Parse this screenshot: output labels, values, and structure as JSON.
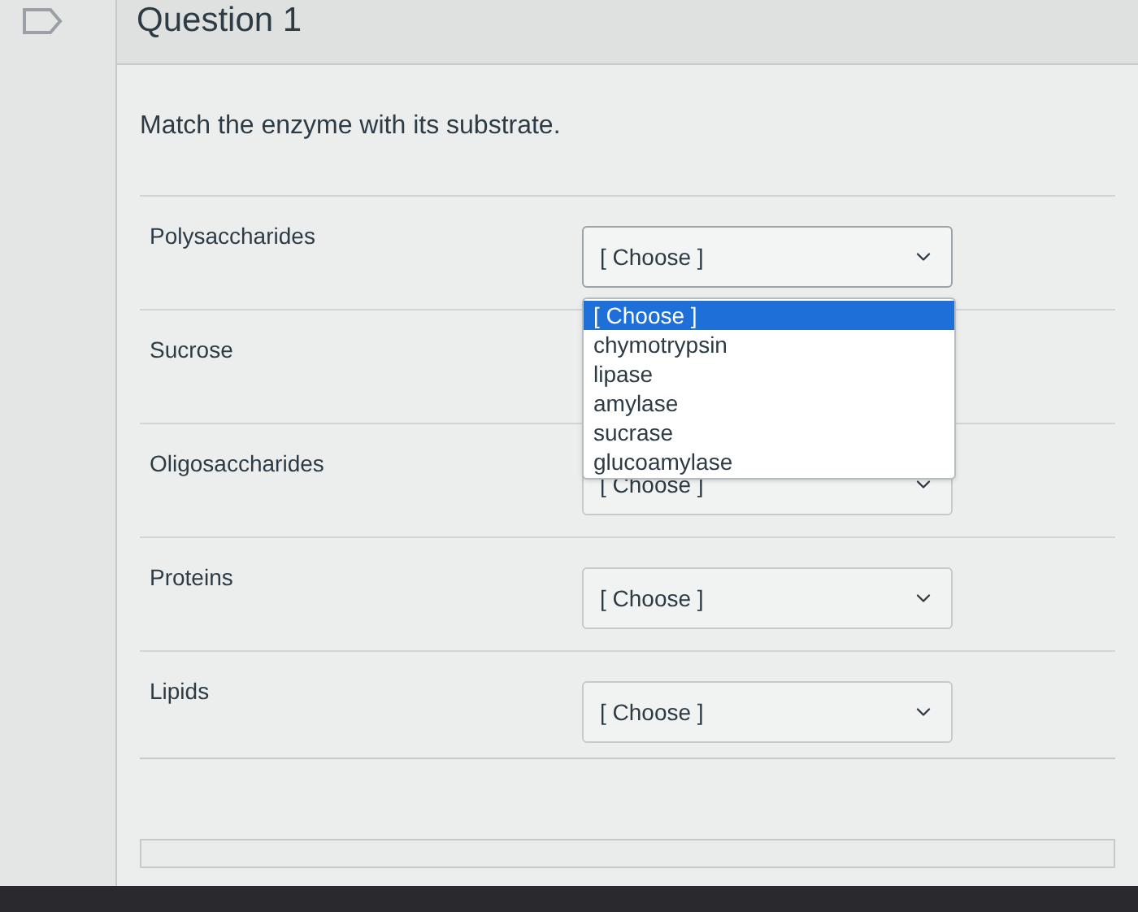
{
  "question": {
    "title": "Question 1",
    "prompt": "Match the enzyme with its substrate.",
    "rows": [
      {
        "label": "Polysaccharides",
        "value": "[ Choose ]",
        "expanded": true
      },
      {
        "label": "Sucrose"
      },
      {
        "label": "Oligosaccharides",
        "value": "[ Choose ]",
        "expanded": false
      },
      {
        "label": "Proteins",
        "value": "[ Choose ]",
        "expanded": false
      },
      {
        "label": "Lipids",
        "value": "[ Choose ]",
        "expanded": false
      }
    ],
    "options": [
      {
        "label": "[ Choose ]",
        "selected": true
      },
      {
        "label": "chymotrypsin",
        "selected": false
      },
      {
        "label": "lipase",
        "selected": false
      },
      {
        "label": "amylase",
        "selected": false
      },
      {
        "label": "sucrase",
        "selected": false
      },
      {
        "label": "glucoamylase",
        "selected": false
      }
    ]
  }
}
